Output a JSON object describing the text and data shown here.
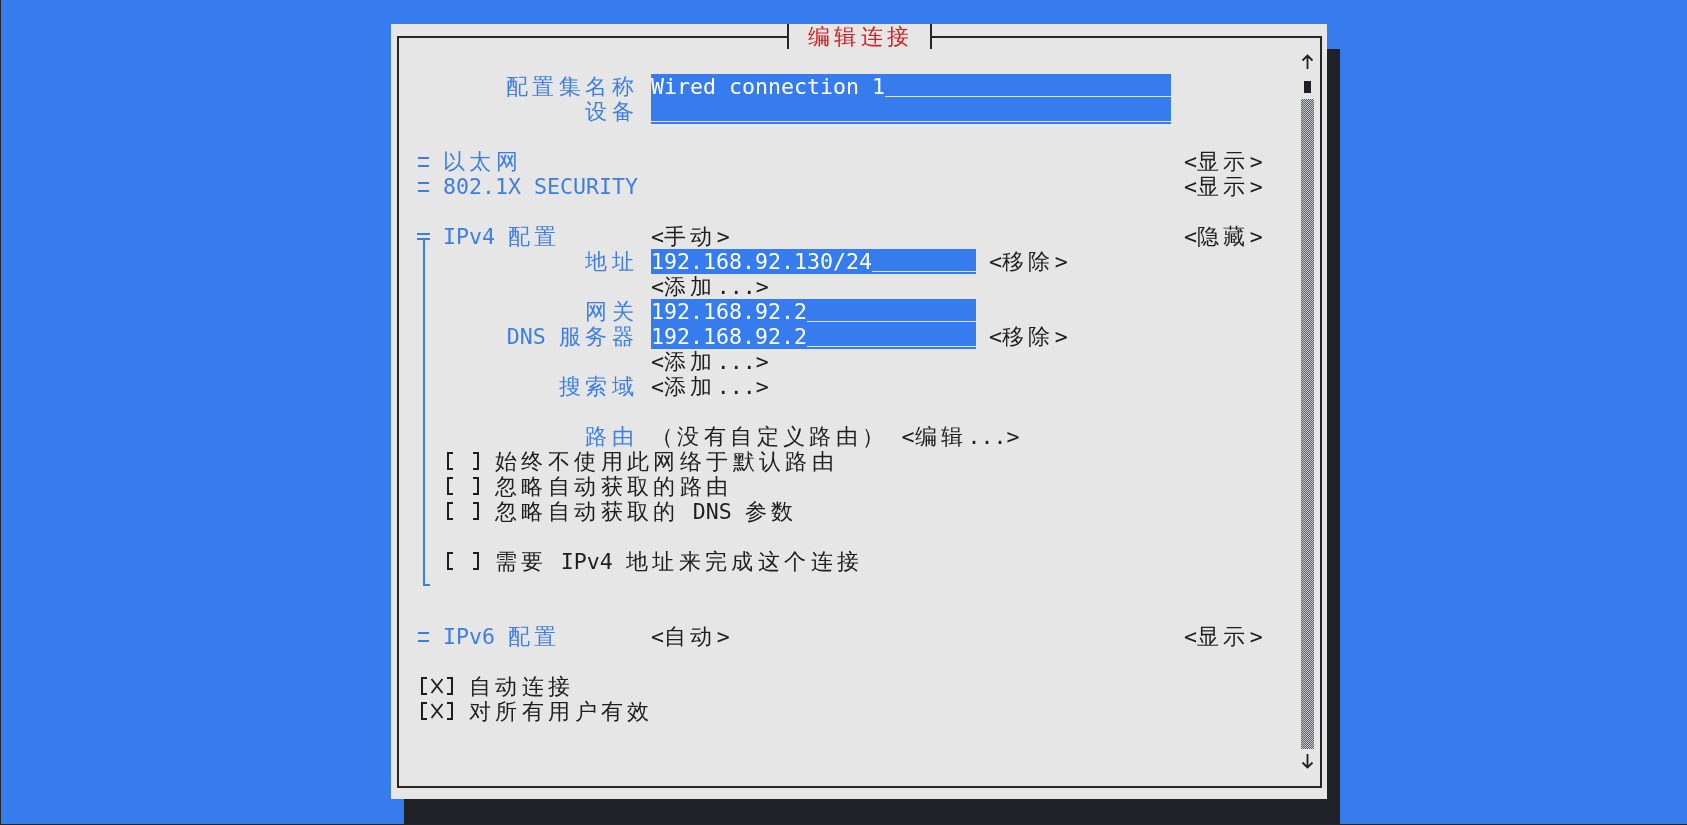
{
  "dialog": {
    "title": "编辑连接"
  },
  "fields": [
    {
      "label": "配置集名称",
      "value": "Wired connection 1"
    },
    {
      "label": "设备"
    }
  ],
  "sections": [
    {
      "title": "以太网",
      "toggle": "<显示>",
      "expanded": false
    },
    {
      "title": "802.1X SECURITY",
      "toggle": "<显示>",
      "expanded": false
    },
    {
      "title": "IPv4 配置",
      "mode": "<手动>",
      "toggle": "<隐藏>",
      "expanded": true,
      "rows": [
        {
          "kind": "list",
          "label": "地址",
          "entries": [
            {
              "value": "192.168.92.130/24",
              "remove": "<移除>"
            }
          ],
          "add": "<添加...>"
        },
        {
          "kind": "field",
          "label": "网关",
          "value": "192.168.92.2"
        },
        {
          "kind": "list",
          "label": "DNS 服务器",
          "entries": [
            {
              "value": "192.168.92.2",
              "remove": "<移除>"
            }
          ],
          "add": "<添加...>"
        },
        {
          "kind": "list",
          "label": "搜索域",
          "add": "<添加...>"
        },
        {
          "kind": "routes",
          "label": "路由",
          "summary": "（没有自定义路由）",
          "edit": "<编辑...>"
        }
      ],
      "route_options": [
        {
          "label": "始终不使用此网络于默认路由",
          "checked": false
        },
        {
          "label": "忽略自动获取的路由",
          "checked": false
        },
        {
          "label": "忽略自动获取的 DNS 参数",
          "checked": false
        }
      ],
      "required": {
        "label": "需要 IPv4 地址来完成这个连接",
        "checked": false
      }
    },
    {
      "title": "IPv6 配置",
      "mode": "<自动>",
      "toggle": "<显示>",
      "expanded": false
    }
  ],
  "options": [
    {
      "label": "自动连接",
      "checked": true
    },
    {
      "label": "对所有用户有效",
      "checked": true
    }
  ]
}
